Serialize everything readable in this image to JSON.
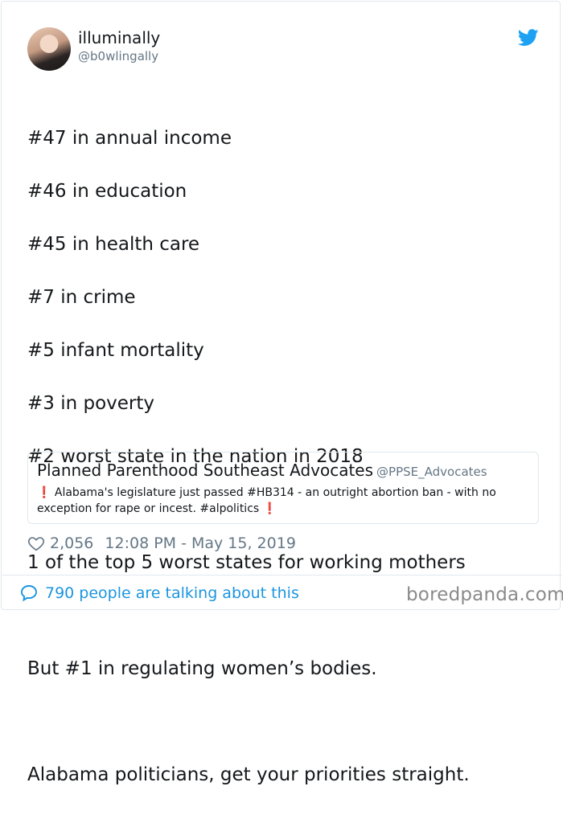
{
  "tweet": {
    "display_name": "illuminally",
    "handle": "@b0wlingally",
    "text_lines": [
      "#47 in annual income",
      "#46 in education",
      "#45 in health care",
      "#7 in crime",
      "#5 infant mortality",
      "#3 in poverty",
      "#2 worst state in the nation in 2018",
      "",
      "1 of the top 5 worst states for working mothers",
      "",
      "But #1 in regulating women’s bodies.",
      "",
      "Alabama politicians, get your priorities straight."
    ],
    "likes": "2,056",
    "timestamp": "12:08 PM - May 15, 2019",
    "talking": "790 people are talking about this"
  },
  "quote": {
    "name": "Planned Parenthood Southeast Advocates",
    "handle": "@PPSE_Advocates",
    "exclaim": "❗",
    "text": "Alabama's legislature just passed #HB314 - an outright abortion ban - with no exception for rape or incest. #alpolitics"
  },
  "watermark": "boredpanda.com",
  "colors": {
    "link": "#1b95e0",
    "muted": "#657786",
    "text": "#14171a",
    "border": "#e1e8ed",
    "alert": "#dd2e44"
  },
  "icons": {
    "brand": "twitter-bird-icon",
    "like": "heart-icon",
    "conversation": "speech-bubble-icon"
  }
}
